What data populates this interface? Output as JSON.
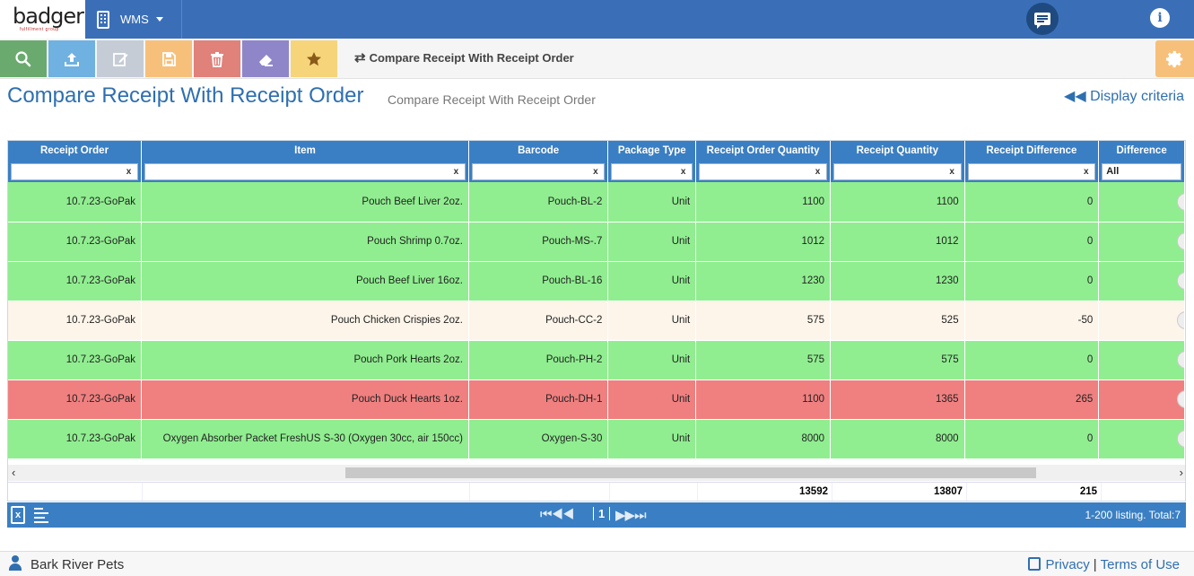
{
  "header": {
    "logo_text": "badger",
    "logo_sub": "fulfillment group",
    "module": "WMS"
  },
  "toolbar": {
    "breadcrumb": "Compare Receipt With Receipt Order",
    "buttons": [
      {
        "name": "search-button",
        "icon": "search-icon",
        "color": "#6aaa6e"
      },
      {
        "name": "upload-button",
        "icon": "upload-icon",
        "color": "#6fb1e0"
      },
      {
        "name": "edit-button",
        "icon": "edit-icon",
        "color": "#c5ccd6"
      },
      {
        "name": "save-button",
        "icon": "save-icon",
        "color": "#f7c07a"
      },
      {
        "name": "delete-button",
        "icon": "trash-icon",
        "color": "#e0817a"
      },
      {
        "name": "clear-button",
        "icon": "eraser-icon",
        "color": "#8f86c9"
      },
      {
        "name": "favorite-button",
        "icon": "star-icon",
        "color": "#f6d57a"
      }
    ]
  },
  "page": {
    "title": "Compare Receipt With Receipt Order",
    "subtitle": "Compare Receipt With Receipt Order",
    "display_criteria": "Display criteria"
  },
  "grid": {
    "columns": [
      "Receipt Order",
      "Item",
      "Barcode",
      "Package Type",
      "Receipt Order Quantity",
      "Receipt Quantity",
      "Receipt Difference",
      "Difference"
    ],
    "filter_select_value": "All",
    "filter_clear": "x",
    "rows": [
      {
        "status": "ok",
        "receipt_order": "10.7.23-GoPak",
        "item": "Pouch Beef Liver 2oz.",
        "barcode": "Pouch-BL-2",
        "package_type": "Unit",
        "order_qty": "1100",
        "receipt_qty": "1100",
        "diff": "0"
      },
      {
        "status": "ok",
        "receipt_order": "10.7.23-GoPak",
        "item": "Pouch Shrimp 0.7oz.",
        "barcode": "Pouch-MS-.7",
        "package_type": "Unit",
        "order_qty": "1012",
        "receipt_qty": "1012",
        "diff": "0"
      },
      {
        "status": "ok",
        "receipt_order": "10.7.23-GoPak",
        "item": "Pouch Beef Liver 16oz.",
        "barcode": "Pouch-BL-16",
        "package_type": "Unit",
        "order_qty": "1230",
        "receipt_qty": "1230",
        "diff": "0"
      },
      {
        "status": "warn",
        "receipt_order": "10.7.23-GoPak",
        "item": "Pouch Chicken Crispies 2oz.",
        "barcode": "Pouch-CC-2",
        "package_type": "Unit",
        "order_qty": "575",
        "receipt_qty": "525",
        "diff": "-50"
      },
      {
        "status": "ok",
        "receipt_order": "10.7.23-GoPak",
        "item": "Pouch Pork Hearts 2oz.",
        "barcode": "Pouch-PH-2",
        "package_type": "Unit",
        "order_qty": "575",
        "receipt_qty": "575",
        "diff": "0"
      },
      {
        "status": "bad",
        "receipt_order": "10.7.23-GoPak",
        "item": "Pouch Duck Hearts 1oz.",
        "barcode": "Pouch-DH-1",
        "package_type": "Unit",
        "order_qty": "1100",
        "receipt_qty": "1365",
        "diff": "265"
      },
      {
        "status": "ok",
        "receipt_order": "10.7.23-GoPak",
        "item": "Oxygen Absorber Packet FreshUS S-30 (Oxygen 30cc, air 150cc)",
        "barcode": "Oxygen-S-30",
        "package_type": "Unit",
        "order_qty": "8000",
        "receipt_qty": "8000",
        "diff": "0"
      }
    ],
    "totals": {
      "order_qty": "13592",
      "receipt_qty": "13807",
      "diff": "215"
    },
    "colors": {
      "ok": "#90ee90",
      "warn": "#fdf5ea",
      "bad": "#f08080",
      "header": "#3a7fc3"
    }
  },
  "pager": {
    "current_page": "1",
    "listing": "1-200 listing. Total:7"
  },
  "footer": {
    "company": "Bark River Pets",
    "privacy": "Privacy",
    "separator": "|",
    "terms": "Terms of Use"
  }
}
